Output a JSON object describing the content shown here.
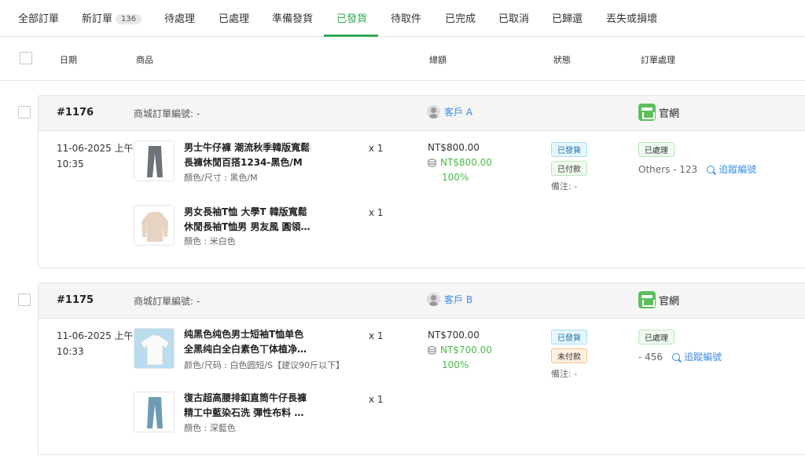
{
  "tabs": [
    {
      "label": "全部訂單"
    },
    {
      "label": "新訂單",
      "count": "136"
    },
    {
      "label": "待處理"
    },
    {
      "label": "已處理"
    },
    {
      "label": "準備發貨"
    },
    {
      "label": "已發貨",
      "active": true
    },
    {
      "label": "待取件"
    },
    {
      "label": "已完成"
    },
    {
      "label": "已取消"
    },
    {
      "label": "已歸還"
    },
    {
      "label": "丟失或損壞"
    }
  ],
  "columns": {
    "date": "日期",
    "product": "商品",
    "total": "總額",
    "status": "狀態",
    "processing": "訂單處理"
  },
  "orders": [
    {
      "id": "#1176",
      "mall_order_no": "商城訂單編號: -",
      "customer": "客戶 A",
      "channel": "官網",
      "date_line1": "11-06-2025 上午",
      "date_line2": "10:35",
      "items": [
        {
          "name_line1": "男士牛仔褲 潮流秋季韓版寬鬆",
          "name_line2": "長褲休閒百搭1234-黑色/M",
          "variant": "顏色/尺寸 : 黑色/M",
          "qty": "x 1",
          "thumb_icon": "jeans-grey-image"
        },
        {
          "name_line1": "男女長袖T恤 大學T 韓版寬鬆",
          "name_line2": "休閒長袖T恤男 男友風 圓領…",
          "variant": "顏色 : 米白色",
          "qty": "x 1",
          "thumb_icon": "sweater-beige-image"
        }
      ],
      "total": "NT$800.00",
      "paid": "NT$800.00",
      "percent": "100%",
      "shipping_status": "已發貨",
      "payment_status": "已付款",
      "payment_color": "green",
      "note": "備注: -",
      "process_status": "已處理",
      "process_ref": "Others - 123",
      "track_label": "追蹤編號"
    },
    {
      "id": "#1175",
      "mall_order_no": "商城訂單編號: -",
      "customer": "客戶 B",
      "channel": "官網",
      "date_line1": "11-06-2025 上午",
      "date_line2": "10:33",
      "items": [
        {
          "name_line1": "纯黑色纯色男士短袖T恤单色",
          "name_line2": "全黑纯白全白素色丅体植净…",
          "variant": "颜色/尺码 : 白色圆短/S【建议90斤以下】",
          "qty": "x 1",
          "thumb_icon": "tshirt-white-image"
        },
        {
          "name_line1": "復古超高腰排釦直筒牛仔長褲",
          "name_line2": "精工中藍染石洗 彈性布料 …",
          "variant": "顏色 : 深藍色",
          "qty": "x 1",
          "thumb_icon": "jeans-blue-image"
        }
      ],
      "total": "NT$700.00",
      "paid": "NT$700.00",
      "percent": "100%",
      "shipping_status": "已發貨",
      "payment_status": "未付款",
      "payment_color": "orange",
      "note": "備注: -",
      "process_status": "已處理",
      "process_ref": "- 456",
      "track_label": "追蹤編號"
    }
  ],
  "colors": {
    "accent": "#34a853",
    "link": "#3a8ee6"
  }
}
